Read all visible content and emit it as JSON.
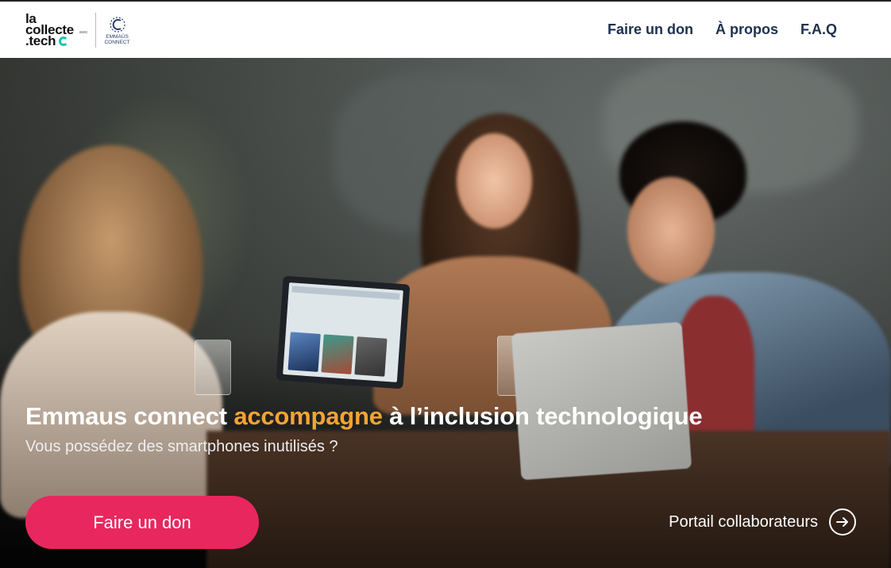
{
  "logo": {
    "line1": "la",
    "line2": "collecte",
    "line3": ".tech",
    "avec": "avec",
    "partner_line1": "EMMAÜS",
    "partner_line2": "CONNECT"
  },
  "nav": {
    "items": [
      {
        "label": "Faire un don"
      },
      {
        "label": "À propos"
      },
      {
        "label": "F.A.Q"
      }
    ]
  },
  "hero": {
    "title_part1": "Emmaus connect ",
    "title_accent": "accompagne",
    "title_part2": " à l’inclusion technologique",
    "subtitle": "Vous possédez des smartphones inutilisés ?",
    "cta_label": "Faire un don",
    "portal_label": "Portail collaborateurs"
  },
  "colors": {
    "accent_orange": "#f6a332",
    "cta_pink": "#e8275f",
    "nav_text": "#1d3050",
    "logo_teal": "#19c7b2",
    "partner_blue": "#2a3d6b"
  },
  "icons": {
    "logo_mark": "swirl-icon",
    "partner_mark": "emmaus-circle-icon",
    "portal": "arrow-right-circle-icon"
  }
}
